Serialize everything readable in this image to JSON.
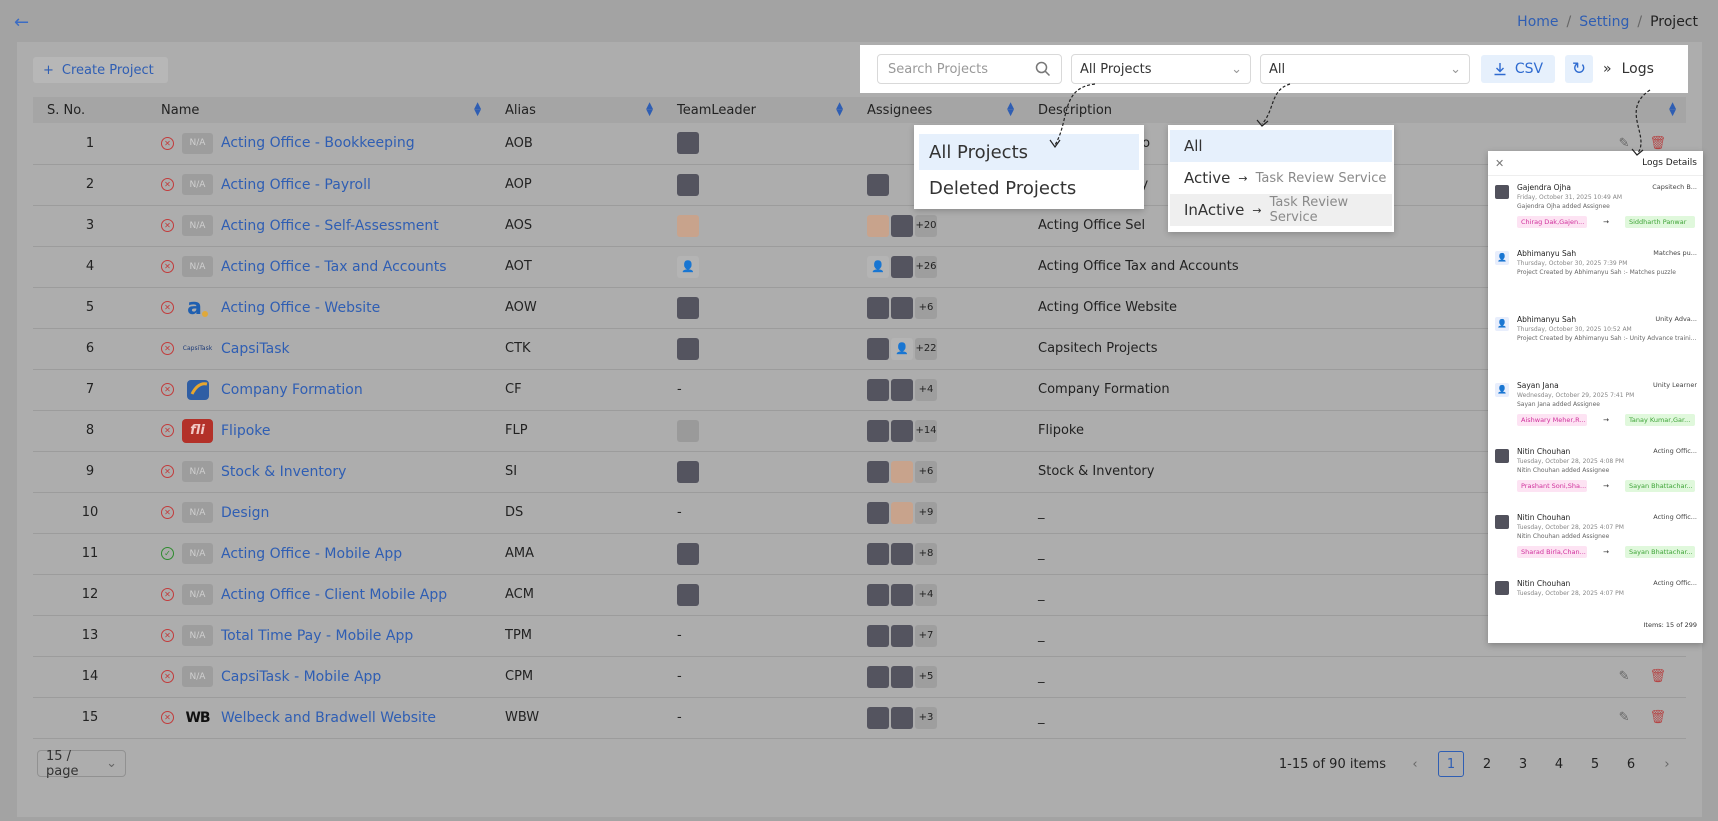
{
  "breadcrumb": {
    "home": "Home",
    "setting": "Setting",
    "current": "Project",
    "sep": "/"
  },
  "create_button": "Create Project",
  "toolbar": {
    "search_placeholder": "Search Projects",
    "project_filter": "All Projects",
    "status_filter": "All",
    "csv_label": "CSV",
    "logs_label": "Logs"
  },
  "table": {
    "columns": [
      "S. No.",
      "Name",
      "Alias",
      "TeamLeader",
      "Assignees",
      "Description"
    ],
    "rows": [
      {
        "sn": "1",
        "name": "Acting Office - Bookkeeping",
        "alias": "AOB",
        "logo": "N/A",
        "status": "inactive",
        "leader": "avatar",
        "assignees": [],
        "more": "",
        "desc": "Acting Office Boo"
      },
      {
        "sn": "2",
        "name": "Acting Office - Payroll",
        "alias": "AOP",
        "logo": "N/A",
        "status": "inactive",
        "leader": "avatar",
        "assignees": [
          "a"
        ],
        "more": "",
        "desc": "Acting Office Pay"
      },
      {
        "sn": "3",
        "name": "Acting Office - Self-Assessment",
        "alias": "AOS",
        "logo": "N/A",
        "status": "inactive",
        "leader": "avatar-l",
        "assignees": [
          "l",
          "a"
        ],
        "more": "+20",
        "desc": "Acting Office Sel"
      },
      {
        "sn": "4",
        "name": "Acting Office - Tax and Accounts",
        "alias": "AOT",
        "logo": "N/A",
        "status": "inactive",
        "leader": "user",
        "assignees": [
          "u",
          "a"
        ],
        "more": "+26",
        "desc": "Acting Office Tax and Accounts"
      },
      {
        "sn": "5",
        "name": "Acting Office - Website",
        "alias": "AOW",
        "logo": "a",
        "status": "inactive",
        "leader": "avatar",
        "assignees": [
          "a",
          "a"
        ],
        "more": "+6",
        "desc": "Acting Office Website"
      },
      {
        "sn": "6",
        "name": "CapsiTask",
        "alias": "CTK",
        "logo": "CapsiTask",
        "status": "inactive",
        "leader": "avatar",
        "assignees": [
          "a",
          "u"
        ],
        "more": "+22",
        "desc": "Capsitech Projects"
      },
      {
        "sn": "7",
        "name": "Company Formation",
        "alias": "CF",
        "logo": "cf",
        "status": "inactive",
        "leader": "-",
        "assignees": [
          "a",
          "a"
        ],
        "more": "+4",
        "desc": "Company Formation"
      },
      {
        "sn": "8",
        "name": "Flipoke",
        "alias": "FLP",
        "logo": "fli",
        "status": "inactive",
        "leader": "avatar-g",
        "assignees": [
          "a",
          "a"
        ],
        "more": "+14",
        "desc": "Flipoke"
      },
      {
        "sn": "9",
        "name": "Stock & Inventory",
        "alias": "SI",
        "logo": "N/A",
        "status": "inactive",
        "leader": "avatar",
        "assignees": [
          "a",
          "l"
        ],
        "more": "+6",
        "desc": "Stock & Inventory"
      },
      {
        "sn": "10",
        "name": "Design",
        "alias": "DS",
        "logo": "N/A",
        "status": "inactive",
        "leader": "-",
        "assignees": [
          "a",
          "l"
        ],
        "more": "+9",
        "desc": "_"
      },
      {
        "sn": "11",
        "name": "Acting Office - Mobile App",
        "alias": "AMA",
        "logo": "N/A",
        "status": "active",
        "leader": "avatar",
        "assignees": [
          "a",
          "a"
        ],
        "more": "+8",
        "desc": "_"
      },
      {
        "sn": "12",
        "name": "Acting Office - Client Mobile App",
        "alias": "ACM",
        "logo": "N/A",
        "status": "inactive",
        "leader": "avatar",
        "assignees": [
          "a",
          "a"
        ],
        "more": "+4",
        "desc": "_"
      },
      {
        "sn": "13",
        "name": "Total Time Pay - Mobile App",
        "alias": "TPM",
        "logo": "N/A",
        "status": "inactive",
        "leader": "-",
        "assignees": [
          "a",
          "a"
        ],
        "more": "+7",
        "desc": "_"
      },
      {
        "sn": "14",
        "name": "CapsiTask - Mobile App",
        "alias": "CPM",
        "logo": "N/A",
        "status": "inactive",
        "leader": "-",
        "assignees": [
          "a",
          "a"
        ],
        "more": "+5",
        "desc": "_"
      },
      {
        "sn": "15",
        "name": "Welbeck and Bradwell Website",
        "alias": "WBW",
        "logo": "WB",
        "status": "inactive",
        "leader": "-",
        "assignees": [
          "a",
          "a"
        ],
        "more": "+3",
        "desc": "_"
      }
    ]
  },
  "pagination": {
    "page_size": "15 / page",
    "range": "1-15 of 90 items",
    "pages": [
      "1",
      "2",
      "3",
      "4",
      "5",
      "6"
    ],
    "current": "1"
  },
  "project_dropdown": {
    "options": [
      "All Projects",
      "Deleted Projects"
    ],
    "selected": "All Projects"
  },
  "status_dropdown": {
    "all": "All",
    "active": "Active",
    "inactive": "InActive",
    "active_sub": "Task Review Service",
    "inactive_sub": "Task Review Service"
  },
  "logs_panel": {
    "title": "Logs Details",
    "items_count": "Items: 15 of 299",
    "entries": [
      {
        "user": "Gajendra Ojha",
        "project": "Capsitech B...",
        "date": "Friday, October 31, 2025 10:49 AM",
        "desc": "Gajendra Ojha added Assignee",
        "from": "Chirag Dak,Gajen...",
        "to": "Siddharth Panwar",
        "icon": "avatar"
      },
      {
        "user": "Abhimanyu Sah",
        "project": "Matches pu...",
        "date": "Thursday, October 30, 2025 7:39 PM",
        "desc": "Project Created by Abhimanyu Sah :- Matches puzzle",
        "from": "",
        "to": "",
        "icon": "user"
      },
      {
        "user": "Abhimanyu Sah",
        "project": "Unity Adva...",
        "date": "Thursday, October 30, 2025 10:52 AM",
        "desc": "Project Created by Abhimanyu Sah :- Unity Advance traini...",
        "from": "",
        "to": "",
        "icon": "user"
      },
      {
        "user": "Sayan Jana",
        "project": "Unity Learner",
        "date": "Wednesday, October 29, 2025 7:41 PM",
        "desc": "Sayan Jana added Assignee",
        "from": "Aishwary Meher,R...",
        "to": "Tanay Kumar,Gar...",
        "icon": "user"
      },
      {
        "user": "Nitin Chouhan",
        "project": "Acting Offic...",
        "date": "Tuesday, October 28, 2025 4:08 PM",
        "desc": "Nitin Chouhan added Assignee",
        "from": "Prashant Soni,Sha...",
        "to": "Sayan Bhattachar...",
        "icon": "avatar"
      },
      {
        "user": "Nitin Chouhan",
        "project": "Acting Offic...",
        "date": "Tuesday, October 28, 2025 4:07 PM",
        "desc": "Nitin Chouhan added Assignee",
        "from": "Sharad Birla,Chan...",
        "to": "Sayan Bhattachar...",
        "icon": "avatar"
      },
      {
        "user": "Nitin Chouhan",
        "project": "Acting Offic...",
        "date": "Tuesday, October 28, 2025 4:07 PM",
        "desc": "",
        "from": "",
        "to": "",
        "icon": "avatar"
      }
    ]
  },
  "colors": {
    "link": "#2f5eb3",
    "inactive": "#c23b3b",
    "active": "#2e8b2e",
    "accent_bg": "#e6f0fc"
  },
  "icons": [
    "back-arrow-icon",
    "plus-icon",
    "search-icon",
    "chevron-down-icon",
    "download-icon",
    "refresh-icon",
    "double-chevron-right-icon",
    "sort-icon",
    "edit-icon",
    "delete-icon",
    "close-icon",
    "arrow-right-icon"
  ]
}
